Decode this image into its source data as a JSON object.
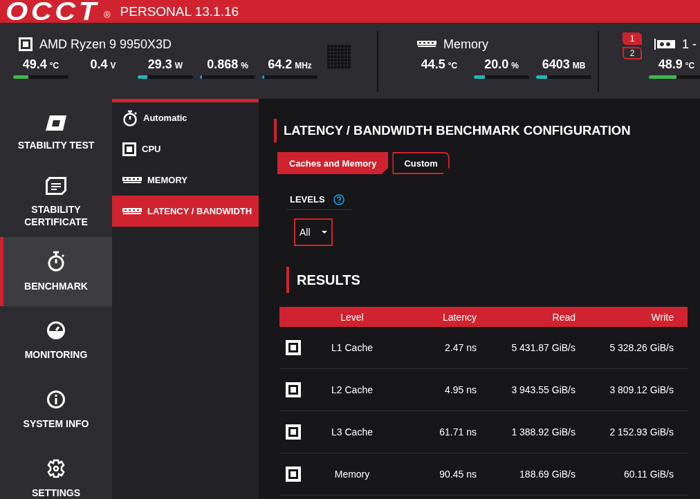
{
  "app": {
    "logo": "OCCT",
    "registered": "®",
    "edition": "PERSONAL 13.1.16"
  },
  "monitors": [
    {
      "kind": "cpu",
      "name": "AMD Ryzen 9 9950X3D",
      "sensors": [
        {
          "value": "49.4",
          "unit": "°C",
          "level": 0.27,
          "color": "#3fb64f"
        },
        {
          "value": "0.4",
          "unit": "V"
        },
        {
          "value": "29.3",
          "unit": "W",
          "level": 0.18,
          "color": "#1fb8b8"
        },
        {
          "value": "0.868",
          "unit": "%",
          "level": 0.01,
          "color": "#1ca0e0"
        },
        {
          "value": "64.2",
          "unit": "MHz",
          "level": 0.01,
          "color": "#1ca0e0"
        }
      ]
    },
    {
      "kind": "memory",
      "name": "Memory",
      "sensors": [
        {
          "value": "44.5",
          "unit": "°C"
        },
        {
          "value": "20.0",
          "unit": "%",
          "level": 0.2,
          "color": "#1fb8b8"
        },
        {
          "value": "6403",
          "unit": "MB",
          "level": 0.2,
          "color": "#1fb8b8"
        }
      ]
    },
    {
      "kind": "gpu",
      "name": "1 -",
      "gpus": [
        {
          "label": "1",
          "selected": true
        },
        {
          "label": "2",
          "selected": false
        }
      ],
      "sensors": [
        {
          "value": "48.9",
          "unit": "°C",
          "level": 0.5,
          "color": "#3fb64f"
        }
      ]
    }
  ],
  "nav": [
    {
      "kind": "stability-test",
      "label": "STABILITY TEST",
      "selected": false
    },
    {
      "kind": "certificate",
      "label": "STABILITY CERTIFICATE",
      "selected": false
    },
    {
      "kind": "benchmark",
      "label": "BENCHMARK",
      "selected": true
    },
    {
      "kind": "monitoring",
      "label": "MONITORING",
      "selected": false
    },
    {
      "kind": "info",
      "label": "SYSTEM INFO",
      "selected": false
    },
    {
      "kind": "settings",
      "label": "SETTINGS",
      "selected": false
    }
  ],
  "subnav": [
    {
      "kind": "stopwatch",
      "label": "Automatic",
      "selected": false
    },
    {
      "kind": "chip",
      "label": "CPU",
      "selected": false
    },
    {
      "kind": "memory",
      "label": "MEMORY",
      "selected": false
    },
    {
      "kind": "memory",
      "label": "LATENCY / BANDWIDTH",
      "selected": true
    }
  ],
  "benchmark": {
    "title": "LATENCY / BANDWIDTH BENCHMARK CONFIGURATION",
    "tabs": [
      {
        "label": "Caches and Memory",
        "selected": true
      },
      {
        "label": "Custom",
        "selected": false
      }
    ],
    "levels_label": "LEVELS",
    "levels_value": "All",
    "results_title": "RESULTS",
    "columns": [
      "Level",
      "Latency",
      "Read",
      "Write"
    ],
    "rows": [
      {
        "checked": true,
        "level": "L1 Cache",
        "latency": "2.47 ns",
        "read": "5 431.87 GiB/s",
        "write": "5 328.26 GiB/s"
      },
      {
        "checked": true,
        "level": "L2 Cache",
        "latency": "4.95 ns",
        "read": "3 943.55 GiB/s",
        "write": "3 809.12 GiB/s"
      },
      {
        "checked": true,
        "level": "L3 Cache",
        "latency": "61.71 ns",
        "read": "1 388.92 GiB/s",
        "write": "2 152.93 GiB/s"
      },
      {
        "checked": true,
        "level": "Memory",
        "latency": "90.45 ns",
        "read": "188.69 GiB/s",
        "write": "60.11 GiB/s"
      }
    ]
  }
}
